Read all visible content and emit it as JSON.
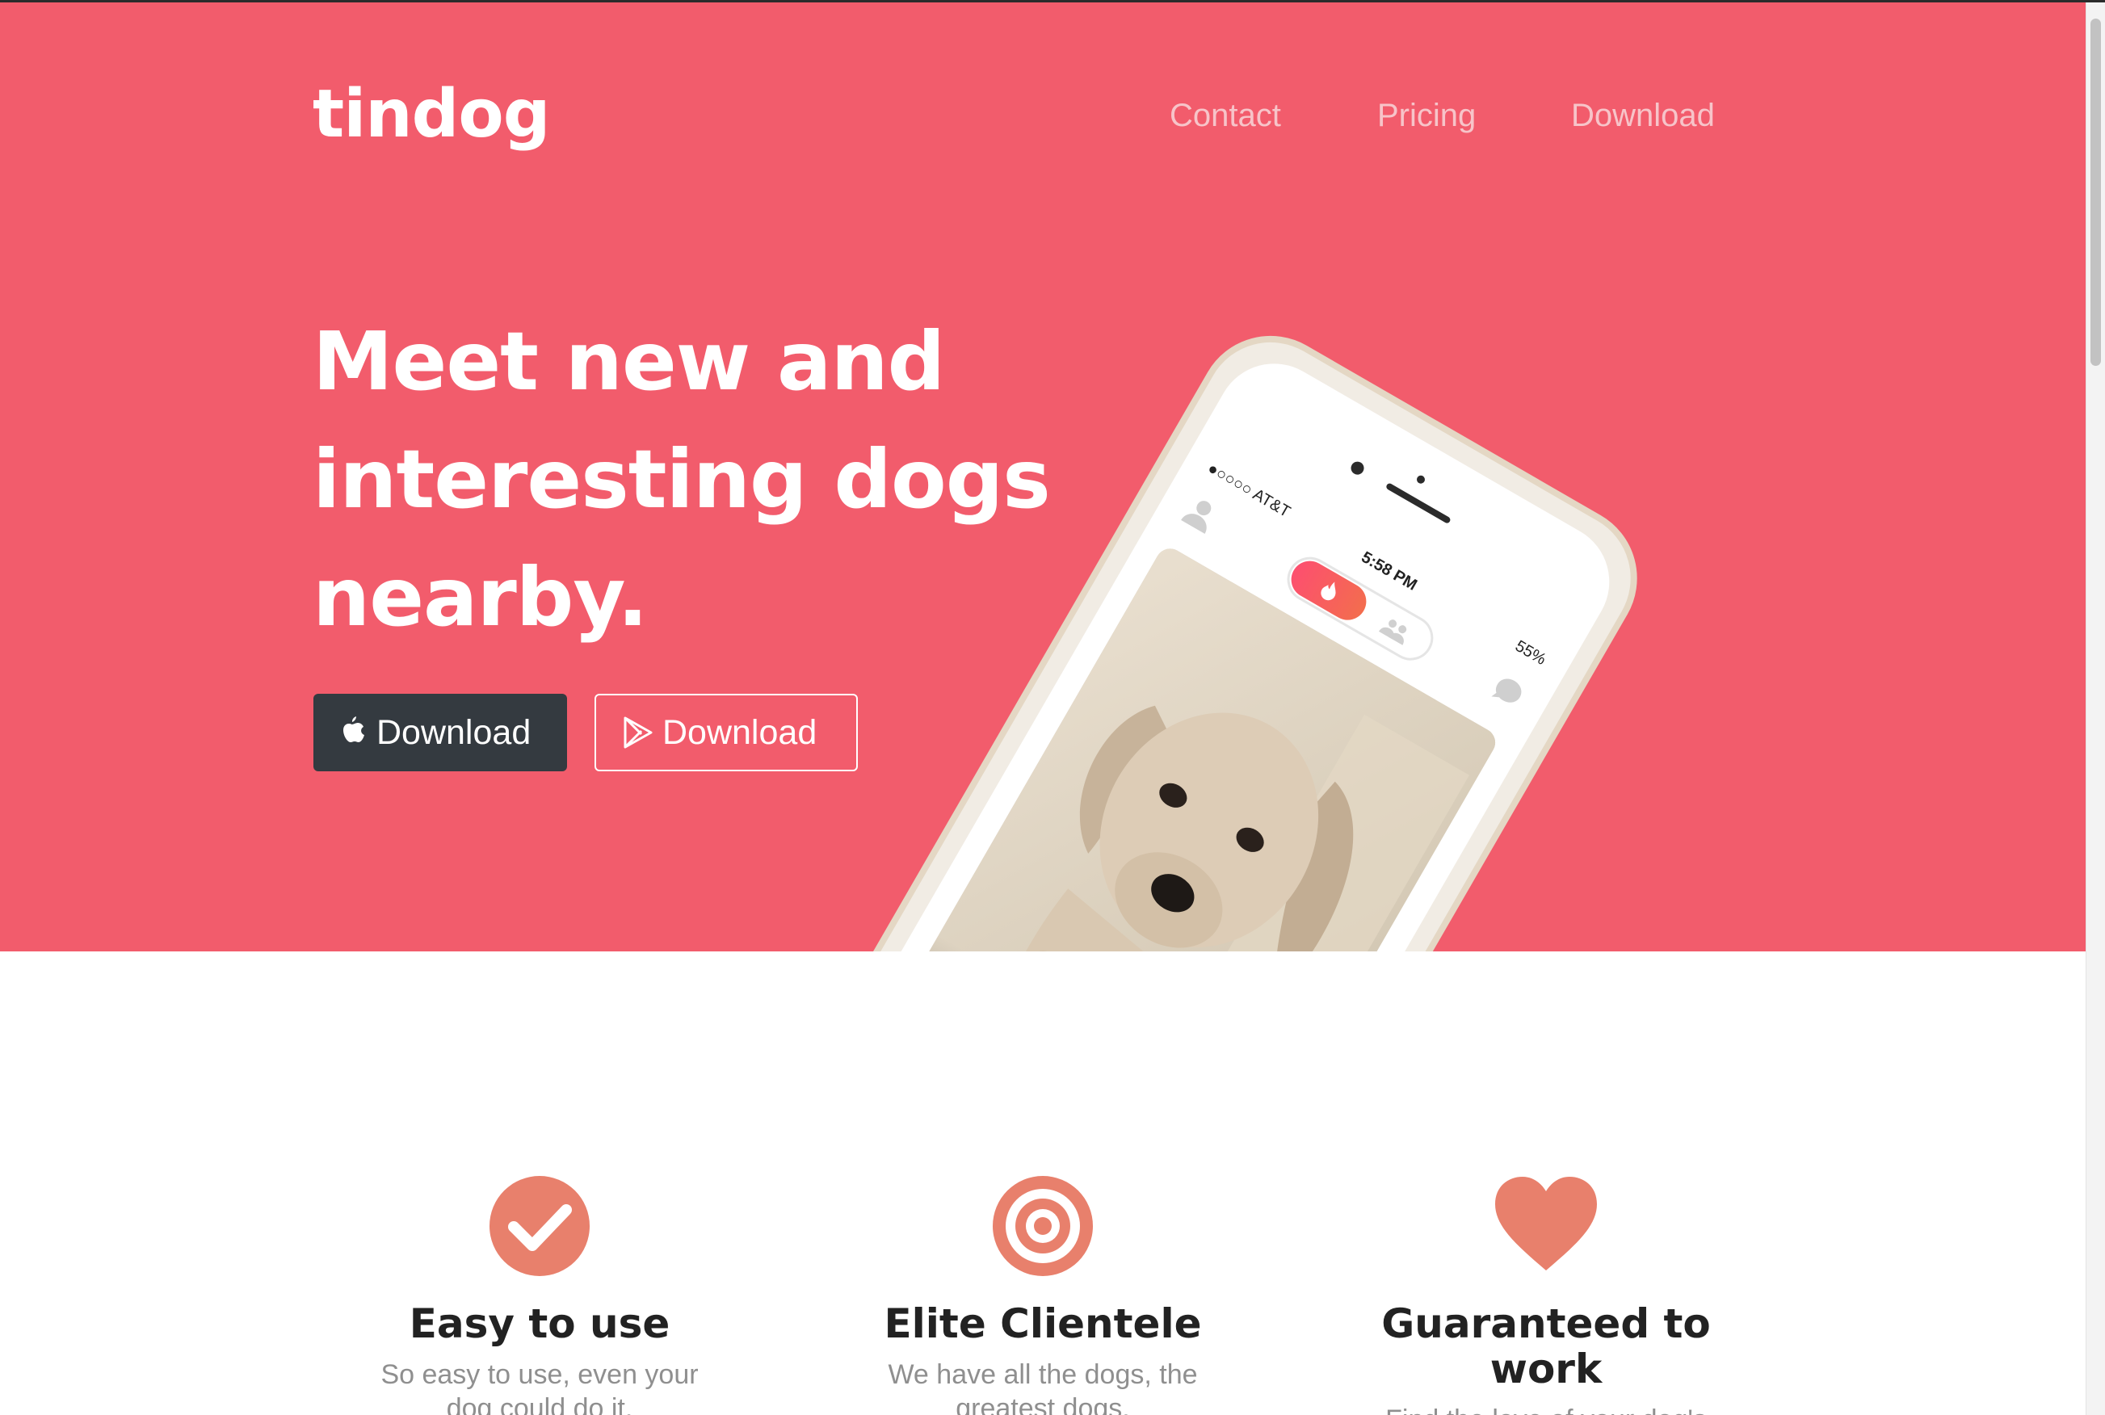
{
  "brand": {
    "logo_text": "tindog"
  },
  "nav": {
    "items": [
      {
        "label": "Contact"
      },
      {
        "label": "Pricing"
      },
      {
        "label": "Download"
      }
    ]
  },
  "hero": {
    "headline_line1": "Meet new and",
    "headline_line2": "interesting dogs",
    "headline_line3": "nearby.",
    "buttons": {
      "apple": {
        "label": "Download",
        "icon": "apple-icon"
      },
      "play": {
        "label": "Download",
        "icon": "google-play-icon"
      }
    },
    "phone": {
      "carrier": "●○○○○ AT&T",
      "time": "5:58 PM",
      "battery": "55%"
    }
  },
  "features": [
    {
      "icon": "check-circle-icon",
      "title": "Easy to use",
      "text": "So easy to use, even your dog could do it."
    },
    {
      "icon": "bullseye-icon",
      "title": "Elite Clientele",
      "text": "We have all the dogs, the greatest dogs."
    },
    {
      "icon": "heart-icon",
      "title": "Guaranteed to work",
      "text": "Find the love of your dog's life or your money back."
    }
  ],
  "colors": {
    "hero_bg": "#F25C6C",
    "icon_accent": "#E8806C",
    "dark_button": "#343a40"
  }
}
